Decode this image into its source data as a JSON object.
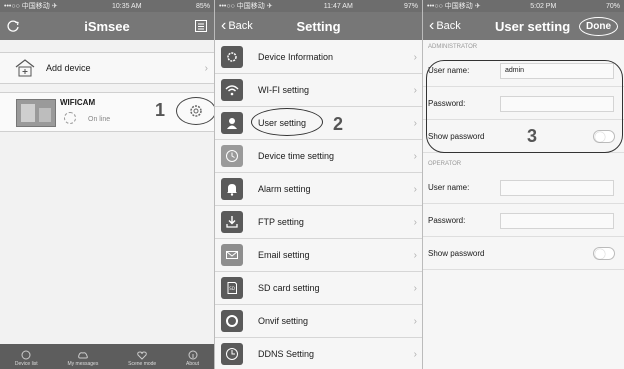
{
  "screen1": {
    "status": {
      "carrier": "•••○○ 中国移动 ✈",
      "time": "10:35 AM",
      "battery": "85%"
    },
    "title": "iSmsee",
    "add_device": "Add device",
    "camera": {
      "name": "WIFICAM",
      "status": "On line"
    },
    "step": "1",
    "tabs": [
      "Device list",
      "My messages",
      "Scene mode",
      "About"
    ]
  },
  "screen2": {
    "status": {
      "carrier": "•••○○ 中国移动 ✈",
      "time": "11:47 AM",
      "battery": "97%"
    },
    "back": "Back",
    "title": "Setting",
    "step": "2",
    "items": [
      {
        "label": "Device Information",
        "icon": "device-info-icon"
      },
      {
        "label": "WI-FI setting",
        "icon": "wifi-icon"
      },
      {
        "label": "User setting",
        "icon": "user-icon"
      },
      {
        "label": "Device time setting",
        "icon": "clock-icon"
      },
      {
        "label": "Alarm setting",
        "icon": "bell-icon"
      },
      {
        "label": "FTP setting",
        "icon": "download-icon"
      },
      {
        "label": "Email setting",
        "icon": "mail-icon"
      },
      {
        "label": "SD card setting",
        "icon": "sd-card-icon"
      },
      {
        "label": "Onvif setting",
        "icon": "onvif-icon"
      },
      {
        "label": "DDNS Setting",
        "icon": "ddns-icon"
      }
    ]
  },
  "screen3": {
    "status": {
      "carrier": "•••○○ 中国移动 ✈",
      "time": "5:02 PM",
      "battery": "70%"
    },
    "back": "Back",
    "title": "User setting",
    "done": "Done",
    "step": "3",
    "admin_header": "ADMINISTRATOR",
    "operator_header": "OPERATOR",
    "admin": {
      "username_label": "User name:",
      "username_value": "admin",
      "password_label": "Password:",
      "show_password": "Show password"
    },
    "operator": {
      "username_label": "User name:",
      "password_label": "Password:",
      "show_password": "Show password"
    }
  }
}
